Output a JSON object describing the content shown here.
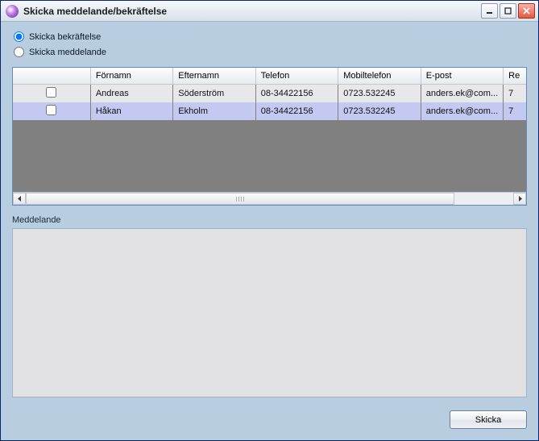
{
  "window": {
    "title": "Skicka meddelande/bekräftelse"
  },
  "options": {
    "confirm_label": "Skicka bekräftelse",
    "message_label": "Skicka meddelande",
    "selected": "confirm"
  },
  "grid": {
    "columns": {
      "check": "",
      "firstname": "Förnamn",
      "lastname": "Efternamn",
      "phone": "Telefon",
      "mobile": "Mobiltelefon",
      "email": "E-post",
      "extra": "Re"
    },
    "rows": [
      {
        "checked": false,
        "firstname": "Andreas",
        "lastname": "Söderström",
        "phone": "08-34422156",
        "mobile": "0723.532245",
        "email": "anders.ek@com...",
        "extra": "7"
      },
      {
        "checked": false,
        "firstname": "Håkan",
        "lastname": "Ekholm",
        "phone": "08-34422156",
        "mobile": "0723.532245",
        "email": "anders.ek@com...",
        "extra": "7"
      }
    ]
  },
  "message": {
    "label": "Meddelande",
    "value": ""
  },
  "actions": {
    "send_label": "Skicka"
  }
}
